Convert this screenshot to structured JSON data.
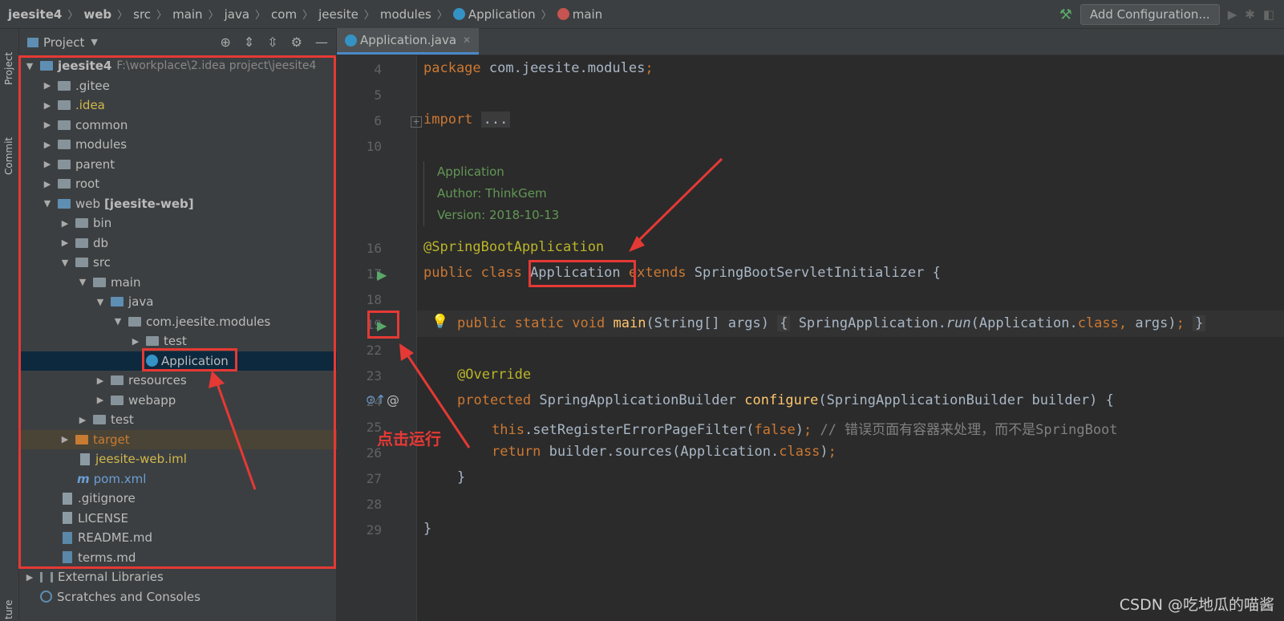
{
  "breadcrumb": [
    "jeesite4",
    "web",
    "src",
    "main",
    "java",
    "com",
    "jeesite",
    "modules",
    "Application",
    "main"
  ],
  "toolbar": {
    "add_configuration": "Add Configuration..."
  },
  "side_tabs": {
    "project": "Project",
    "commit": "Commit",
    "structure": "ture"
  },
  "project_panel": {
    "title": "Project"
  },
  "tree": {
    "root_name": "jeesite4",
    "root_path": "F:\\workplace\\2.idea project\\jeesite4",
    "gitee": ".gitee",
    "idea": ".idea",
    "common": "common",
    "modules": "modules",
    "parent": "parent",
    "root": "root",
    "web": "web",
    "web_module": "[jeesite-web]",
    "bin": "bin",
    "db": "db",
    "src": "src",
    "main": "main",
    "java": "java",
    "package": "com.jeesite.modules",
    "test_pkg": "test",
    "application": "Application",
    "resources": "resources",
    "webapp": "webapp",
    "test": "test",
    "target": "target",
    "iml": "jeesite-web.iml",
    "pom": "pom.xml",
    "gitignore": ".gitignore",
    "license": "LICENSE",
    "readme": "README.md",
    "terms": "terms.md",
    "external_libs": "External Libraries",
    "scratches": "Scratches and Consoles"
  },
  "editor": {
    "tab": "Application.java",
    "line_numbers": [
      "4",
      "5",
      "6",
      "10",
      "16",
      "17",
      "18",
      "19",
      "22",
      "23",
      "24",
      "25",
      "26",
      "27",
      "28",
      "29"
    ],
    "doc": {
      "title": "Application",
      "author_label": "Author:",
      "author": "ThinkGem",
      "version_label": "Version:",
      "version": "2018-10-13"
    },
    "comment": "// 错误页面有容器来处理，而不是SpringBoot"
  },
  "annotation_label": "点击运行",
  "watermark": "CSDN @吃地瓜的喵酱"
}
